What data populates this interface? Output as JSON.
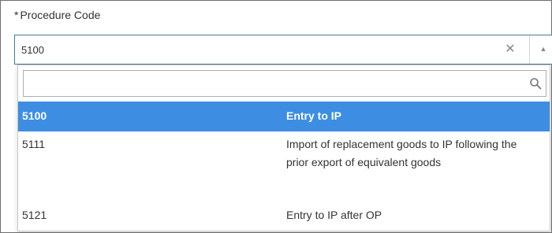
{
  "field": {
    "required_marker": "*",
    "label": "Procedure Code",
    "value": "5100"
  },
  "icons": {
    "clear": "close-icon",
    "caret": "caret-up-icon",
    "search": "search-icon"
  },
  "search": {
    "value": "",
    "placeholder": ""
  },
  "options": [
    {
      "code": "5100",
      "desc": "Entry to IP",
      "selected": true
    },
    {
      "code": "5111",
      "desc": "Import of replacement goods to IP following the prior export of equivalent goods",
      "selected": false
    },
    {
      "code": "5121",
      "desc": "Entry to IP after OP",
      "selected": false
    }
  ],
  "colors": {
    "selected_bg": "#3d8ee3",
    "select_border": "#3f7f8a"
  }
}
